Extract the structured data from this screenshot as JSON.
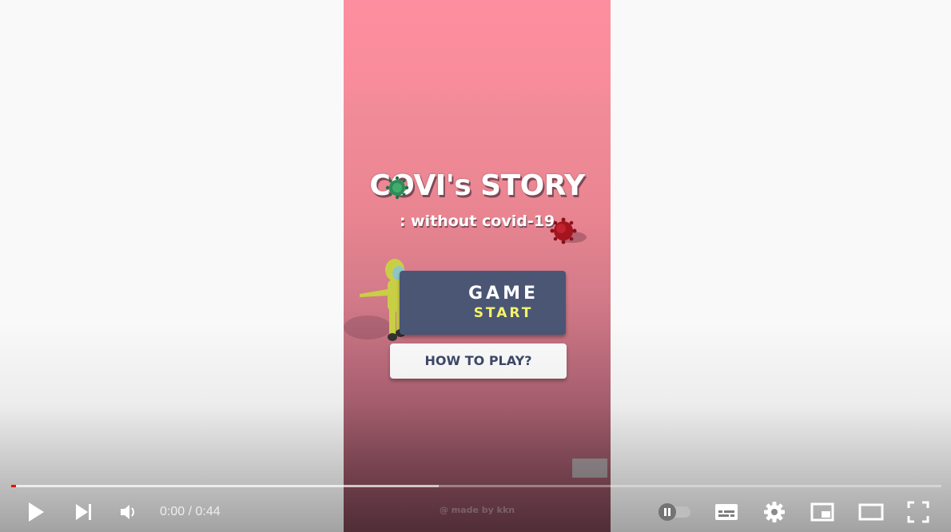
{
  "video": {
    "title_main": "COVI's STORY",
    "title_sub": ": without covid-19",
    "game_start_line1": "GAME",
    "game_start_line2": "START",
    "how_to_play": "HOW TO PLAY?",
    "credit": "@ made by kkn"
  },
  "controls": {
    "play_icon": "play-icon",
    "next_icon": "skip-next-icon",
    "volume_icon": "volume-icon",
    "time_display": "0:00 / 0:44",
    "autoplay_icon": "autoplay-toggle-icon",
    "subtitles_icon": "subtitles-icon",
    "settings_icon": "gear-icon",
    "miniplayer_icon": "miniplayer-icon",
    "theater_icon": "theater-mode-icon",
    "fullscreen_icon": "fullscreen-icon"
  },
  "progress": {
    "played_fraction": 0.005,
    "loaded_fraction": 0.46
  },
  "colors": {
    "accent_red": "#ff0000",
    "button_navy": "#4a5674",
    "start_yellow": "#f4f36a",
    "bg": "#f9f9f9"
  }
}
